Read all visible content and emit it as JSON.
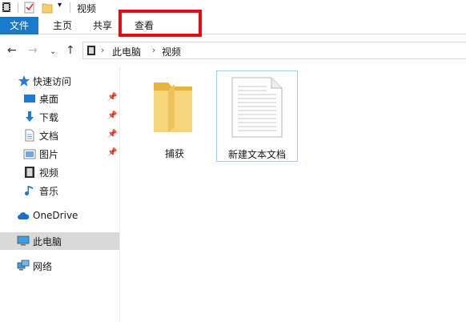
{
  "window": {
    "title": "视频"
  },
  "ribbon": {
    "tabs": [
      {
        "label": "文件",
        "active": true
      },
      {
        "label": "主页"
      },
      {
        "label": "共享"
      },
      {
        "label": "查看"
      }
    ],
    "highlight_color": "#e00d12",
    "file_tab_color": "#1979ca"
  },
  "address": {
    "crumbs": [
      "此电脑",
      "视频"
    ]
  },
  "sidebar": {
    "quick_access": "快速访问",
    "quick_items": [
      {
        "label": "桌面",
        "icon": "desktop-icon"
      },
      {
        "label": "下载",
        "icon": "download-icon"
      },
      {
        "label": "文档",
        "icon": "document-icon"
      },
      {
        "label": "图片",
        "icon": "pictures-icon"
      },
      {
        "label": "视频",
        "icon": "video-icon"
      },
      {
        "label": "音乐",
        "icon": "music-icon"
      }
    ],
    "onedrive": "OneDrive",
    "this_pc": "此电脑",
    "network": "网络"
  },
  "files": [
    {
      "name": "捕获",
      "type": "folder"
    },
    {
      "name": "新建文本文档",
      "type": "text-document"
    }
  ]
}
